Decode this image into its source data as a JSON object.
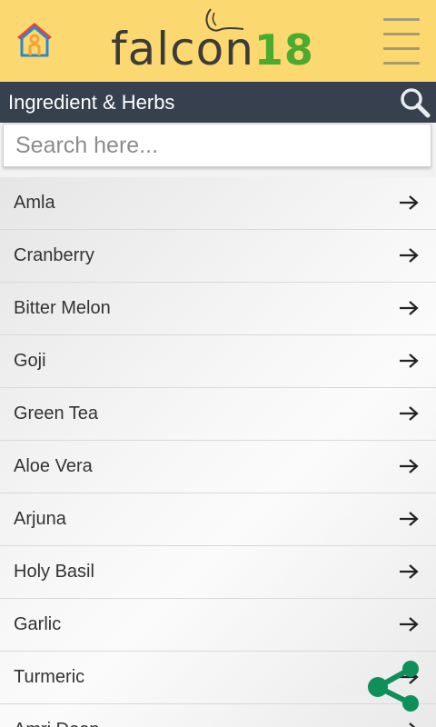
{
  "header": {
    "home_icon": "home-icon",
    "logo": {
      "text_word": "falcon",
      "text_number": "18",
      "brand_green": "#4caa2f",
      "brand_dark": "#3b3b3b"
    },
    "menu_icon": "hamburger-menu-icon",
    "background": "#fcd870"
  },
  "titlebar": {
    "title": "Ingredient & Herbs",
    "search_icon": "search-icon",
    "background": "#37404f"
  },
  "search": {
    "placeholder": "Search here...",
    "value": ""
  },
  "list": {
    "items": [
      {
        "label": "Amla"
      },
      {
        "label": "Cranberry"
      },
      {
        "label": "Bitter Melon"
      },
      {
        "label": "Goji"
      },
      {
        "label": "Green Tea"
      },
      {
        "label": "Aloe Vera"
      },
      {
        "label": "Arjuna"
      },
      {
        "label": "Holy Basil"
      },
      {
        "label": "Garlic"
      },
      {
        "label": "Turmeric"
      },
      {
        "label": "Amri Deep"
      }
    ],
    "item_icon": "arrow-right-icon"
  },
  "fab": {
    "icon": "share-icon",
    "color": "#0f8f5a"
  }
}
